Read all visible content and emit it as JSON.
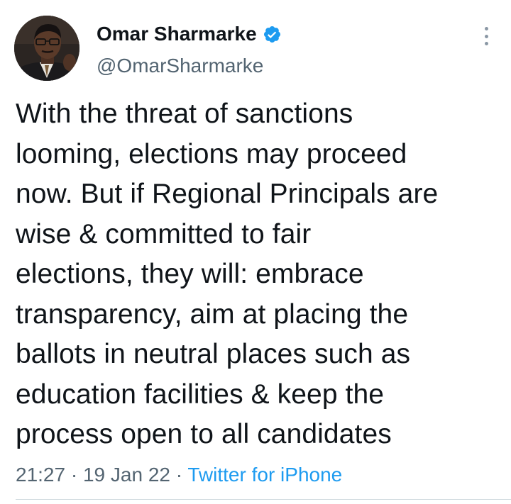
{
  "author": {
    "display_name": "Omar Sharmarke",
    "handle": "@OmarSharmarke",
    "verified": true,
    "verified_color": "#1d9bf0"
  },
  "tweet": {
    "text_lines": [
      "With the threat of sanctions",
      "looming, elections may proceed",
      "now. But if Regional Principals are",
      "wise & committed to fair",
      "elections, they will: embrace",
      "transparency, aim at placing the",
      "ballots in neutral places such as",
      "education facilities & keep the",
      "process open to all candidates"
    ],
    "time": "21:27",
    "separator": "·",
    "date": "19 Jan 22",
    "source": "Twitter for iPhone"
  },
  "icons": {
    "more": "more-vertical-icon",
    "verified": "verified-badge-icon",
    "avatar": "profile-photo"
  },
  "colors": {
    "text": "#0f1419",
    "secondary": "#536471",
    "link": "#1d9bf0",
    "divider": "#cfd9de"
  }
}
